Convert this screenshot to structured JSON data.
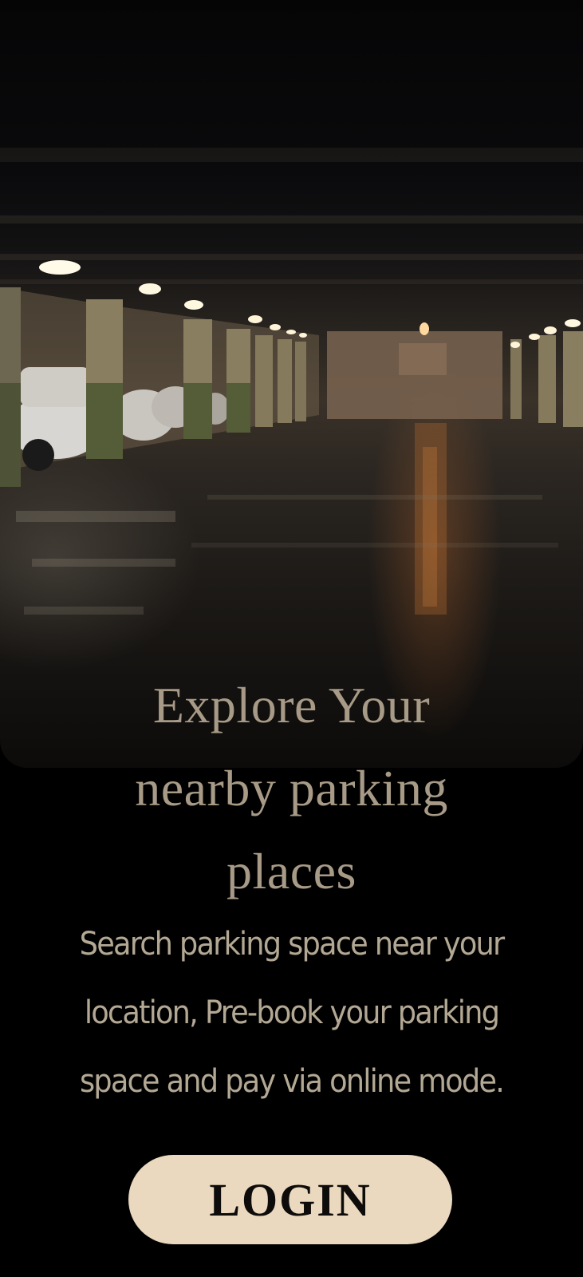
{
  "hero": {
    "image": "parking-garage-photo",
    "headline_line1": "Explore Your",
    "headline_line2": "nearby parking",
    "headline_line3": "places"
  },
  "description": {
    "line1": "Search parking space near your",
    "line2": "location, Pre-book your parking",
    "line3": "space and pay via online mode."
  },
  "login_button": {
    "label": "LOGIN"
  },
  "colors": {
    "background": "#000000",
    "headline_text": "#a79a86",
    "body_text": "#b3a894",
    "button_bg": "#ead8bf",
    "button_text": "#0e0c0a"
  }
}
